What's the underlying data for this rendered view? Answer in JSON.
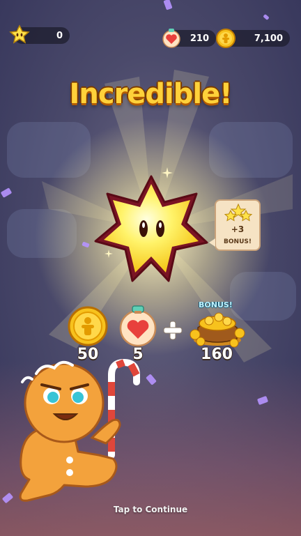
{
  "topbar": {
    "stars": "0",
    "hearts": "210",
    "coins": "7,100"
  },
  "title": "Incredible!",
  "bonus_bubble": {
    "count": "+3",
    "label": "BONUS!"
  },
  "rewards": [
    {
      "icon": "coin-icon",
      "value": "50"
    },
    {
      "icon": "heart-potion-icon",
      "value": "5"
    },
    {
      "icon": "coin-pile-icon",
      "value": "160",
      "badge": "BONUS!"
    }
  ],
  "footer": {
    "continue_text": "Tap to Continue"
  },
  "colors": {
    "title": "#ffd13a",
    "coin": "#f7c21d",
    "heart": "#e8413c",
    "confetti": "#b693ff",
    "cookie": "#f3a23c"
  }
}
